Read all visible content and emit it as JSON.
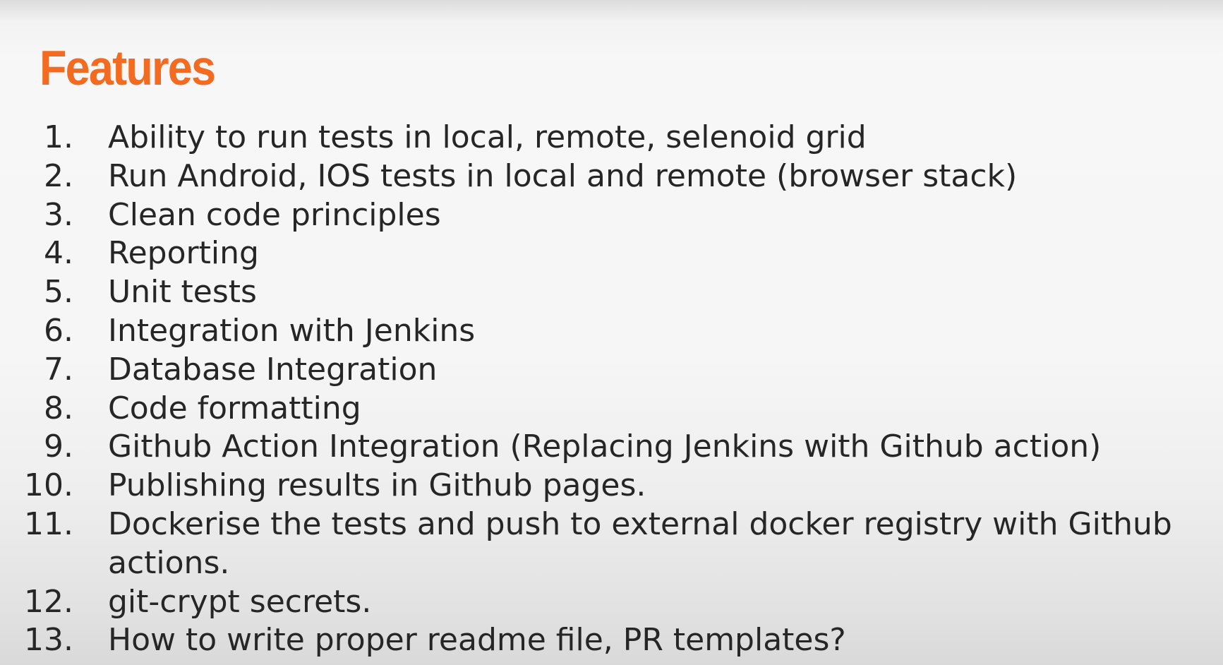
{
  "slide": {
    "title": "Features",
    "items": [
      {
        "number": "1.",
        "text": "Ability to run tests in local, remote, selenoid grid"
      },
      {
        "number": "2.",
        "text": "Run Android, IOS tests in local and remote (browser stack)"
      },
      {
        "number": "3.",
        "text": "Clean code principles"
      },
      {
        "number": "4.",
        "text": "Reporting"
      },
      {
        "number": "5.",
        "text": "Unit tests"
      },
      {
        "number": "6.",
        "text": "Integration with Jenkins"
      },
      {
        "number": "7.",
        "text": "Database Integration"
      },
      {
        "number": "8.",
        "text": "Code formatting"
      },
      {
        "number": "9.",
        "text": "Github Action Integration (Replacing Jenkins with Github action)"
      },
      {
        "number": "10.",
        "text": "Publishing results in Github pages."
      },
      {
        "number": "11.",
        "text": "Dockerise the tests and push to external docker registry with Github actions."
      },
      {
        "number": "12.",
        "text": "git-crypt secrets."
      },
      {
        "number": "13.",
        "text": "How to write proper readme file, PR templates?"
      }
    ]
  },
  "colors": {
    "title": "#f26b21",
    "text": "#262626"
  }
}
